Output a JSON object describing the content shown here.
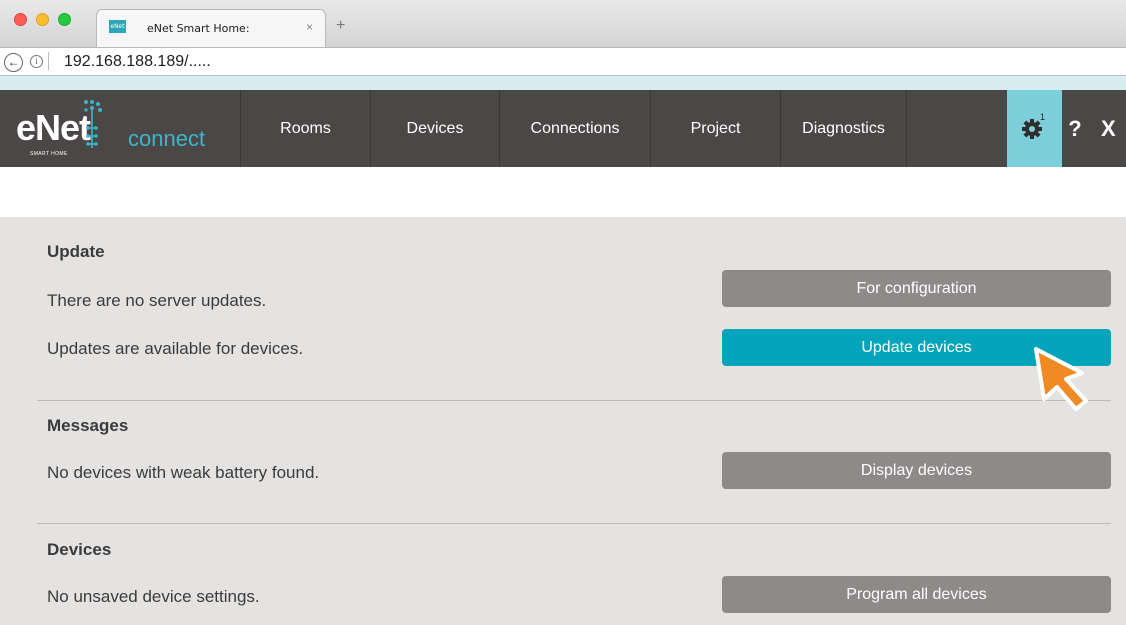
{
  "browser": {
    "tab_title": "eNet Smart Home:",
    "tab_favicon_text": "eNet",
    "tab_close": "×",
    "new_tab": "+",
    "back": "←",
    "info": "i",
    "url": "192.168.188.189/....."
  },
  "logo": {
    "word": "eNet",
    "sub": "SMART HOME",
    "connect": "connect"
  },
  "nav": {
    "rooms": "Rooms",
    "devices": "Devices",
    "connections": "Connections",
    "project": "Project",
    "diagnostics": "Diagnostics",
    "settings_badge": "1",
    "help": "?",
    "close": "X"
  },
  "sections": {
    "update": {
      "title": "Update",
      "server_status": "There are no server updates.",
      "device_status": "Updates are available for devices.",
      "config_button": "For configuration",
      "update_button": "Update devices"
    },
    "messages": {
      "title": "Messages",
      "battery_status": "No devices with weak battery found.",
      "display_button": "Display devices"
    },
    "devices": {
      "title": "Devices",
      "settings_status": "No unsaved device settings.",
      "program_button": "Program all devices"
    }
  },
  "colors": {
    "nav_bg": "#4b4746",
    "accent": "#04a5bb",
    "settings_active": "#7ccfdb",
    "button_grey": "#8d8a89",
    "cursor": "#f08a24"
  }
}
